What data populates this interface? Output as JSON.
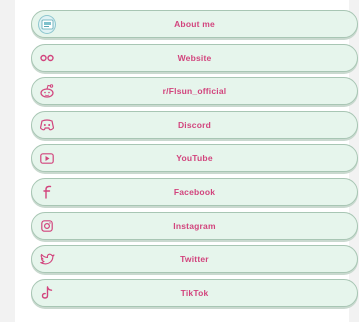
{
  "links": [
    {
      "label": "About me",
      "icon": "avatar"
    },
    {
      "label": "Website",
      "icon": "infinity-icon"
    },
    {
      "label": "r/Flsun_official",
      "icon": "reddit-icon"
    },
    {
      "label": "Discord",
      "icon": "discord-icon"
    },
    {
      "label": "YouTube",
      "icon": "youtube-icon"
    },
    {
      "label": "Facebook",
      "icon": "facebook-icon"
    },
    {
      "label": "Instagram",
      "icon": "instagram-icon"
    },
    {
      "label": "Twitter",
      "icon": "twitter-icon"
    },
    {
      "label": "TikTok",
      "icon": "tiktok-icon"
    }
  ],
  "colors": {
    "button_bg": "#e6f5ec",
    "button_border": "#a8c6b4",
    "label": "#d2447d",
    "icon": "#d2447d",
    "page_bg": "#ffffff"
  }
}
